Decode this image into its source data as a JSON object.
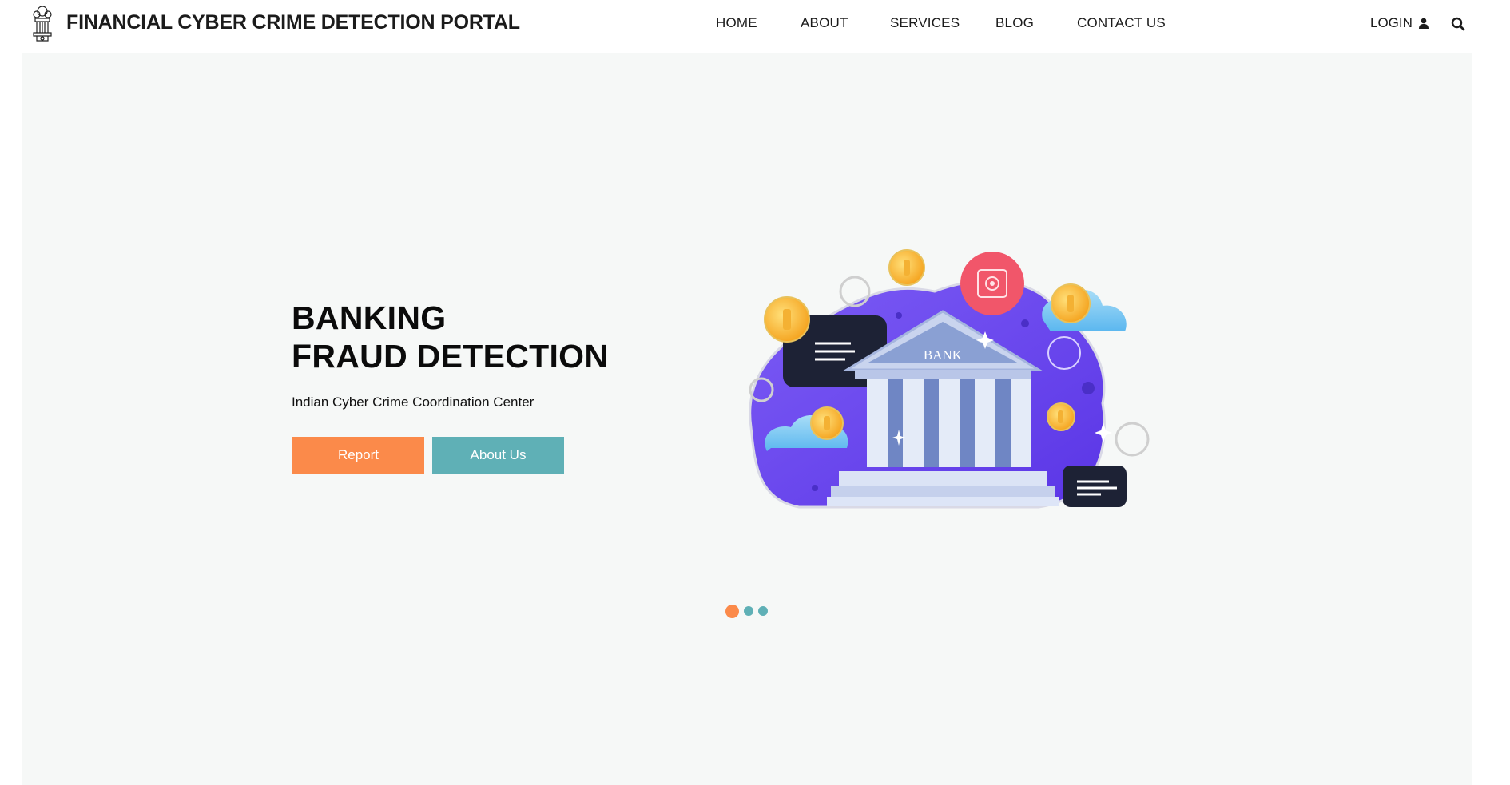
{
  "header": {
    "brand": "FINANCIAL CYBER CRIME DETECTION PORTAL",
    "logo_icon": "emblem-icon",
    "nav": [
      {
        "label": "HOME"
      },
      {
        "label": "ABOUT"
      },
      {
        "label": "SERVICES"
      },
      {
        "label": "BLOG"
      },
      {
        "label": "CONTACT US"
      }
    ],
    "login_label": "LOGIN",
    "login_icon": "user-icon",
    "search_icon": "search-icon"
  },
  "hero": {
    "title_line1": "BANKING",
    "title_line2": "FRAUD DETECTION",
    "subtitle": "Indian Cyber Crime Coordination Center",
    "report_label": "Report",
    "about_label": "About Us",
    "illustration_text": "BANK",
    "slider": {
      "count": 3,
      "active": 1
    }
  },
  "colors": {
    "accent_orange": "#fb8a4a",
    "accent_teal": "#5fb0b6",
    "hero_bg": "#f6f8f7",
    "illustration_purple": "#6b48f0"
  }
}
